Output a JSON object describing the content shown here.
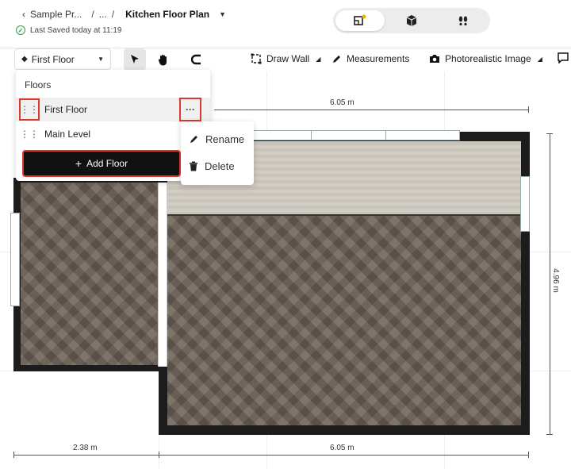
{
  "header": {
    "back_label": "Sample Pr...",
    "sep1": "/",
    "ellipsis": "...",
    "sep2": "/",
    "title": "Kitchen Floor Plan",
    "saved_text": "Last Saved today at 11:19"
  },
  "view_toggle": {
    "items": [
      {
        "icon": "2d-plan-icon",
        "active": true
      },
      {
        "icon": "3d-cube-icon",
        "active": false
      },
      {
        "icon": "footprints-icon",
        "active": false
      }
    ]
  },
  "toolbar": {
    "floor_select_value": "First Floor",
    "draw_wall_label": "Draw Wall",
    "measurements_label": "Measurements",
    "photorealistic_label": "Photorealistic Image"
  },
  "floors_panel": {
    "title": "Floors",
    "floors": [
      {
        "label": "First Floor",
        "selected": true
      },
      {
        "label": "Main Level",
        "selected": false
      }
    ],
    "add_floor_label": "Add Floor"
  },
  "context_menu": {
    "rename_label": "Rename",
    "delete_label": "Delete"
  },
  "dimensions": {
    "top": "6.05 m",
    "right": "4.96 m",
    "bottom_left": "2.38 m",
    "bottom_right": "6.05 m"
  },
  "colors": {
    "highlight": "#d93a2b",
    "wall": "#1c1c1c",
    "success": "#3a9a4a"
  }
}
